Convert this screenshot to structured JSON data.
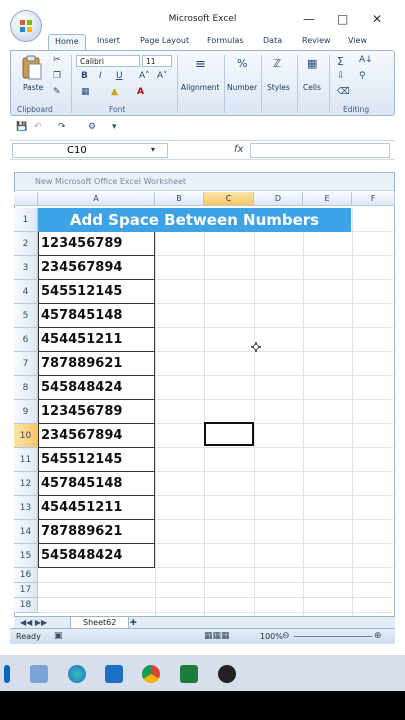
{
  "app": {
    "title": "Microsoft Excel"
  },
  "ribbon": {
    "tabs": [
      "Home",
      "Insert",
      "Page Layout",
      "Formulas",
      "Data",
      "Review",
      "View"
    ],
    "clipboard_label": "Clipboard",
    "paste_label": "Paste",
    "font_label": "Font",
    "font_name": "Calibri",
    "font_size": "11",
    "alignment_label": "Alignment",
    "number_label": "Number",
    "styles_label": "Styles",
    "cells_label": "Cells",
    "editing_label": "Editing"
  },
  "formula_bar": {
    "name_box": "C10",
    "fx": "fx",
    "formula": ""
  },
  "workbook": {
    "title": "New Microsoft Office Excel Worksheet"
  },
  "grid": {
    "columns": [
      "A",
      "B",
      "C",
      "D",
      "E",
      "F"
    ],
    "selected_column": "C",
    "rows": [
      "1",
      "2",
      "3",
      "4",
      "5",
      "6",
      "7",
      "8",
      "9",
      "10",
      "11",
      "12",
      "13",
      "14",
      "15",
      "16",
      "17",
      "18"
    ],
    "selected_row": "10",
    "title": "Add Space Between Numbers",
    "numbers": [
      "123456789",
      "234567894",
      "545512145",
      "457845148",
      "454451211",
      "787889621",
      "545848424",
      "123456789",
      "234567894",
      "545512145",
      "457845148",
      "454451211",
      "787889621",
      "545848424"
    ]
  },
  "sheets": {
    "active": "Sheet62"
  },
  "status": {
    "ready": "Ready",
    "zoom": "100%"
  },
  "colors": {
    "title_fill": "#3ea3e6",
    "title_text": "#ffffff",
    "selection_header": "#f5c766"
  }
}
